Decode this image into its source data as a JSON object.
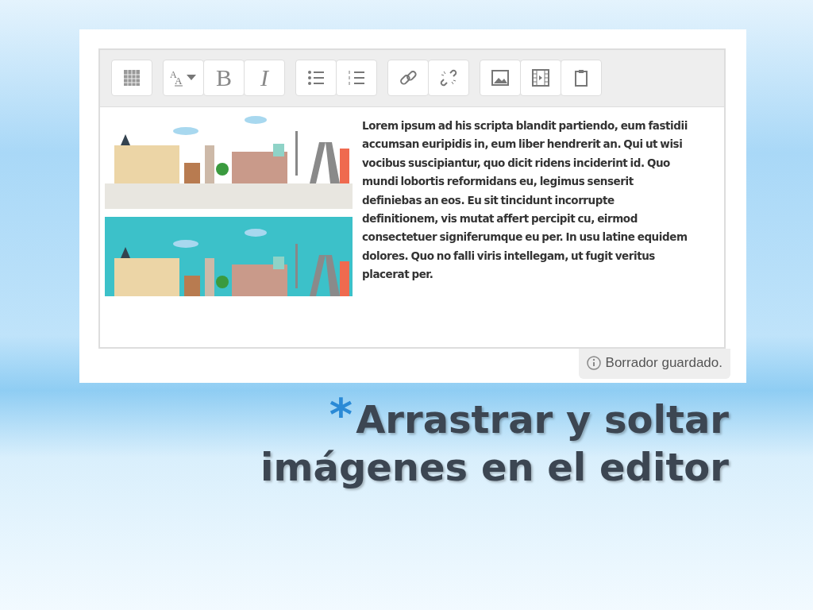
{
  "editor": {
    "toolbar": [
      [
        {
          "kind": "table"
        }
      ],
      [
        {
          "kind": "font-color",
          "letters": [
            "A",
            "A"
          ]
        },
        {
          "kind": "bold",
          "label": "B"
        },
        {
          "kind": "italic",
          "label": "I"
        }
      ],
      [
        {
          "kind": "bullets"
        },
        {
          "kind": "numbers"
        }
      ],
      [
        {
          "kind": "link"
        },
        {
          "kind": "unlink"
        }
      ],
      [
        {
          "kind": "image"
        },
        {
          "kind": "video"
        },
        {
          "kind": "paste"
        }
      ]
    ],
    "images": [
      {
        "kind": "plain"
      },
      {
        "kind": "sky"
      }
    ],
    "text": "Lorem ipsum ad his scripta blandit partiendo, eum fastidii accumsan euripidis in, eum liber hendrerit an. Qui ut wisi vocibus suscipiantur, quo dicit ridens inciderint id. Quo mundi lobortis reformidans eu, legimus senserit definiebas an eos. Eu sit tincidunt incorrupte definitionem, vis mutat affert percipit cu, eirmod consectetuer signiferumque eu per. In usu latine equidem dolores. Quo no falli viris intellegam, ut fugit veritus placerat per.",
    "status": "Borrador guardado."
  },
  "title": {
    "bullet": "*",
    "lines": [
      "Arrastrar y soltar",
      "imágenes en el editor"
    ]
  }
}
